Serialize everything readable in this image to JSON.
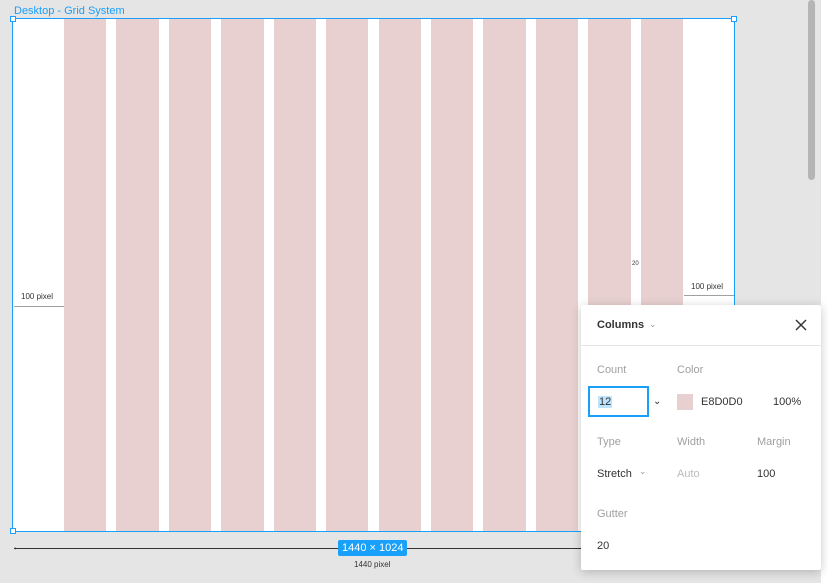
{
  "frame": {
    "label": "Desktop - Grid System",
    "size_badge": "1440 × 1024",
    "width_caption": "1440 pixel",
    "left_margin_label": "100 pixel",
    "right_margin_label": "100 pixel",
    "gutter_label": "20"
  },
  "grid": {
    "column_count": 12,
    "color": "#e8d0d0"
  },
  "popover": {
    "title": "Columns",
    "labels": {
      "count": "Count",
      "color": "Color",
      "type": "Type",
      "width": "Width",
      "margin": "Margin",
      "gutter": "Gutter"
    },
    "count_value": "12",
    "color_hex": "E8D0D0",
    "opacity": "100%",
    "type_value": "Stretch",
    "width_placeholder": "Auto",
    "margin_value": "100",
    "gutter_value": "20"
  },
  "colors": {
    "selection": "#18a0fb",
    "column": "#e8d0d0"
  },
  "icons": {
    "close": "close-icon",
    "chevron": "chevron-down-icon",
    "arrow": "arrow-left-icon"
  }
}
